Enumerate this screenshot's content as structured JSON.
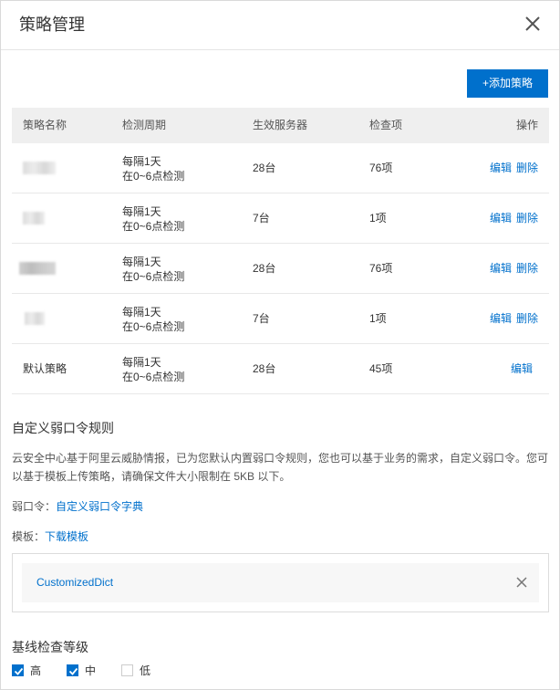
{
  "dialog": {
    "title": "策略管理",
    "close_icon": "close-icon"
  },
  "toolbar": {
    "add_label": "+添加策略"
  },
  "table": {
    "headers": [
      "策略名称",
      "检测周期",
      "生效服务器",
      "检查项",
      "操作"
    ],
    "rows": [
      {
        "name": "",
        "period_line1": "每隔1天",
        "period_line2": "在0~6点检测",
        "servers": "28台",
        "items": "76项",
        "edit": "编辑",
        "delete": "删除"
      },
      {
        "name": "",
        "period_line1": "每隔1天",
        "period_line2": "在0~6点检测",
        "servers": "7台",
        "items": "1项",
        "edit": "编辑",
        "delete": "删除"
      },
      {
        "name": "",
        "period_line1": "每隔1天",
        "period_line2": "在0~6点检测",
        "servers": "28台",
        "items": "76项",
        "edit": "编辑",
        "delete": "删除"
      },
      {
        "name": "",
        "period_line1": "每隔1天",
        "period_line2": "在0~6点检测",
        "servers": "7台",
        "items": "1项",
        "edit": "编辑",
        "delete": "删除"
      },
      {
        "name": "默认策略",
        "period_line1": "每隔1天",
        "period_line2": "在0~6点检测",
        "servers": "28台",
        "items": "45项",
        "edit": "编辑"
      }
    ]
  },
  "weak_password": {
    "title": "自定义弱口令规则",
    "desc_line1": "云安全中心基于阿里云威胁情报，已为您默认内置弱口令规则，您也可以基于业务的需求，自定义弱口令。您可",
    "desc_line2": "以基于模板上传策略，请确保文件大小限制在 5KB 以下。",
    "dict_label": "弱口令：",
    "dict_link": "自定义弱口令字典",
    "template_label": "模板：",
    "template_link": "下载模板",
    "file_name": "CustomizedDict"
  },
  "baseline": {
    "title": "基线检查等级",
    "levels": [
      {
        "label": "高",
        "checked": true
      },
      {
        "label": "中",
        "checked": true
      },
      {
        "label": "低",
        "checked": false
      }
    ]
  },
  "colors": {
    "primary": "#0070cc",
    "header_bg": "#efefef"
  }
}
